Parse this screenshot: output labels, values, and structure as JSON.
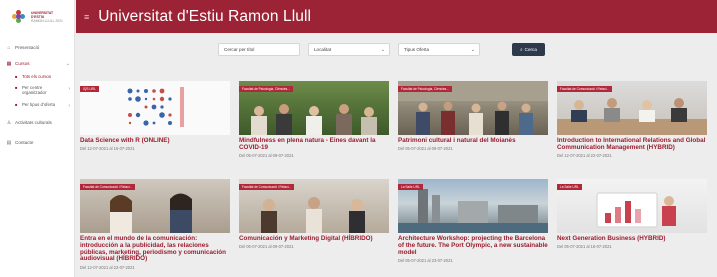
{
  "sidebar": {
    "logo_line1": "UNIVERSITAT D'ESTIU",
    "logo_line2": "RAMON LLULL 2021",
    "items": [
      {
        "label": "Presentació",
        "icon": "home-icon"
      },
      {
        "label": "Cursos",
        "icon": "grid-icon"
      },
      {
        "label": "Activitats culturals",
        "icon": "person-icon"
      },
      {
        "label": "Contacte",
        "icon": "contact-card-icon"
      }
    ],
    "subitems": [
      {
        "label": "Tots els cursos"
      },
      {
        "label": "Per centre organitzador"
      },
      {
        "label": "Per tipus d'oferta"
      }
    ]
  },
  "header": {
    "title": "Universitat d'Estiu Ramon Llull"
  },
  "filters": {
    "title_placeholder": "Cercar per títol",
    "locality": "Localitat",
    "offer_type": "Tipus Oferta",
    "search_label": "Cerca"
  },
  "courses": [
    {
      "tag": "IQS URL",
      "title": "Data Science with R (ONLINE)",
      "date": "Del 12-07-2021 al 16-07-2021"
    },
    {
      "tag": "Facultat de Psicologia, Ciències...",
      "title": "Mindfulness en plena natura - Eines davant la COVID-19",
      "date": "Del 05-07-2021 al 09-07-2021"
    },
    {
      "tag": "Facultat de Psicologia, Ciències...",
      "title": "Patrimoni cultural i natural del Moianès",
      "date": "Del 05-07-2021 al 09-07-2021"
    },
    {
      "tag": "Facultat de Comunicació i Relaci...",
      "title": "Introduction to International Relations and Global Communication Management (HYBRID)",
      "date": "Del 12-07-2021 al 22-07-2021"
    },
    {
      "tag": "Facultat de Comunicació i Relaci...",
      "title": "Entra en el mundo de la comunicación: introducción a la publicidad, las relaciones públicas, marketing, periodismo y comunicación audiovisual (HÍBRIDO)",
      "date": "Del 12-07-2021 al 22-07-2021"
    },
    {
      "tag": "Facultat de Comunicació i Relaci...",
      "title": "Comunicación y Marketing Digital (HÍBRIDO)",
      "date": "Del 05-07-2021 al 09-07-2021"
    },
    {
      "tag": "La Salle URL",
      "title": "Architecture Workshop: projecting the Barcelona of the future. The Port Olympic, a new sustainable model",
      "date": "Del 05-07-2021 al 23-07-2021"
    },
    {
      "tag": "La Salle URL",
      "title": "Next Generation Business (HYBRID)",
      "date": "Del 05-07-2021 al 16-07-2021"
    }
  ],
  "colors": {
    "brand": "#9b2335",
    "search_button": "#2e3a4c"
  }
}
